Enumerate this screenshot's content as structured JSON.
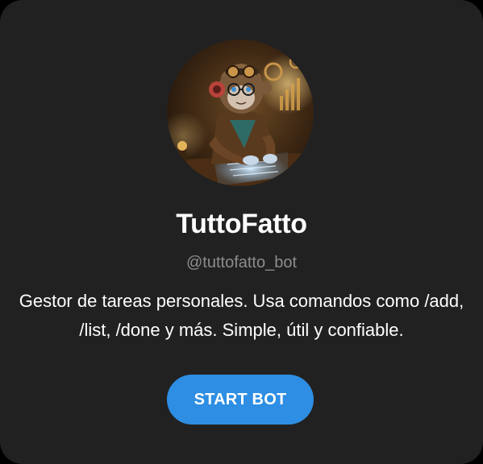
{
  "bot": {
    "name": "TuttoFatto",
    "username": "@tuttofatto_bot",
    "description": "Gestor de tareas personales. Usa comandos como /add, /list, /done y más. Simple, útil y confiable.",
    "avatar_icon": "monkey-with-goggles-at-laptop"
  },
  "actions": {
    "start_label": "START BOT"
  },
  "colors": {
    "card_background": "#212121",
    "accent": "#2d8ee3",
    "muted_text": "#8c8c8c"
  }
}
